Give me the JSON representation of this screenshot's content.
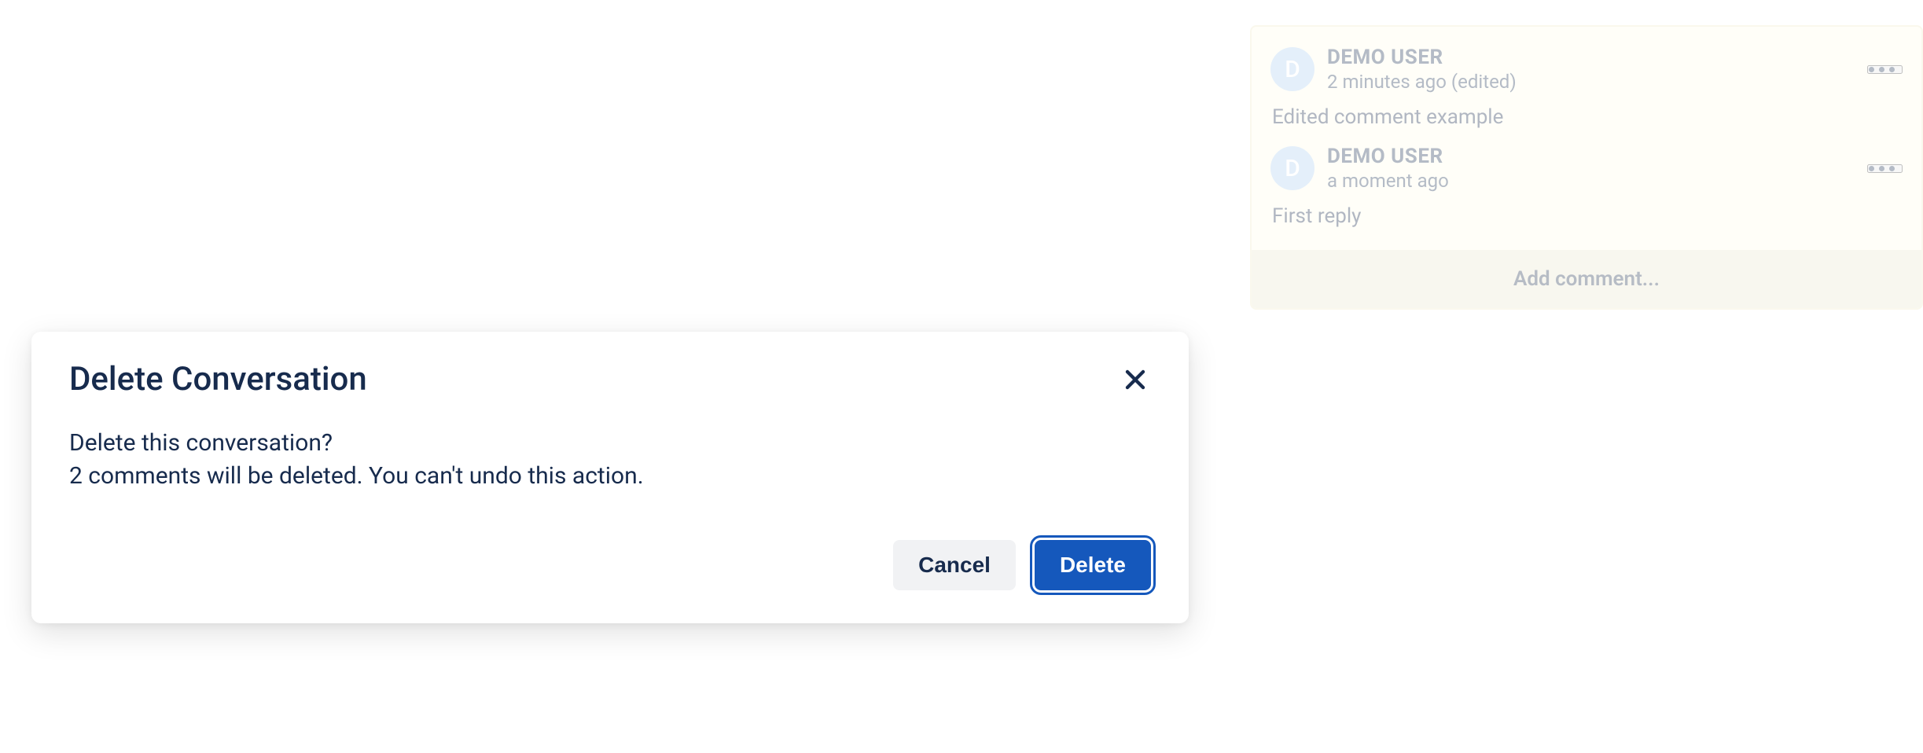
{
  "thread": {
    "comments": [
      {
        "avatar_initial": "D",
        "author": "DEMO USER",
        "time": "2 minutes ago (edited)",
        "body": "Edited comment example"
      },
      {
        "avatar_initial": "D",
        "author": "DEMO USER",
        "time": "a moment ago",
        "body": "First reply"
      }
    ],
    "add_comment_label": "Add comment..."
  },
  "modal": {
    "title": "Delete Conversation",
    "body_line1": "Delete this conversation?",
    "body_line2": "2 comments will be deleted. You can't undo this action.",
    "cancel_label": "Cancel",
    "delete_label": "Delete"
  }
}
